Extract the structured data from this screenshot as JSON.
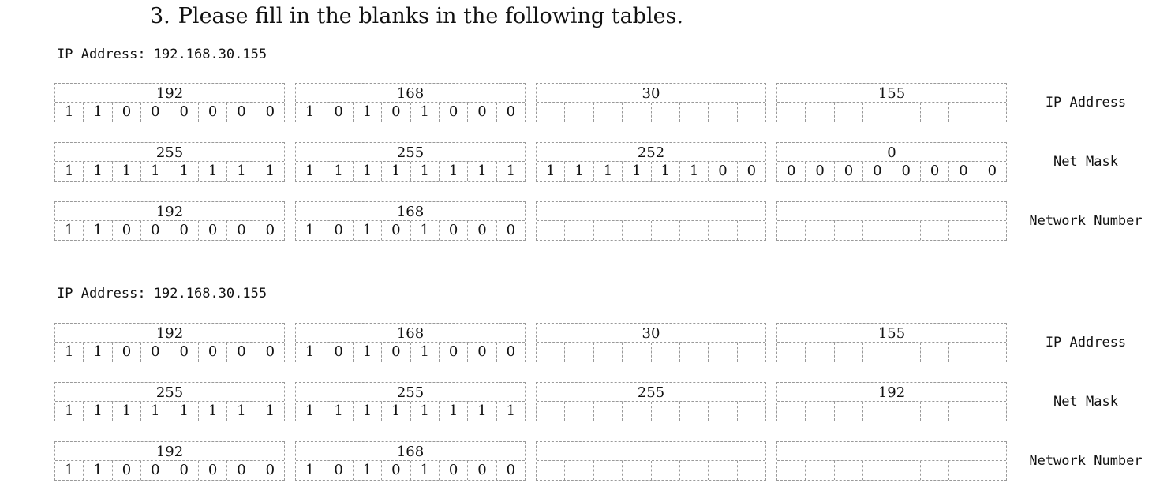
{
  "heading": {
    "number": "3.",
    "text": "Please fill in the blanks in the following tables."
  },
  "tables": [
    {
      "ip_line": "IP Address: 192.168.30.155",
      "rows": [
        {
          "label": "IP Address",
          "octets": [
            {
              "dec": "192",
              "bits": [
                "1",
                "1",
                "0",
                "0",
                "0",
                "0",
                "0",
                "0"
              ]
            },
            {
              "dec": "168",
              "bits": [
                "1",
                "0",
                "1",
                "0",
                "1",
                "0",
                "0",
                "0"
              ]
            },
            {
              "dec": "30",
              "bits": [
                "",
                "",
                "",
                "",
                "",
                "",
                "",
                ""
              ]
            },
            {
              "dec": "155",
              "bits": [
                "",
                "",
                "",
                "",
                "",
                "",
                "",
                ""
              ]
            }
          ]
        },
        {
          "label": "Net Mask",
          "octets": [
            {
              "dec": "255",
              "bits": [
                "1",
                "1",
                "1",
                "1",
                "1",
                "1",
                "1",
                "1"
              ]
            },
            {
              "dec": "255",
              "bits": [
                "1",
                "1",
                "1",
                "1",
                "1",
                "1",
                "1",
                "1"
              ]
            },
            {
              "dec": "252",
              "bits": [
                "1",
                "1",
                "1",
                "1",
                "1",
                "1",
                "0",
                "0"
              ]
            },
            {
              "dec": "0",
              "bits": [
                "0",
                "0",
                "0",
                "0",
                "0",
                "0",
                "0",
                "0"
              ]
            }
          ]
        },
        {
          "label": "Network Number",
          "octets": [
            {
              "dec": "192",
              "bits": [
                "1",
                "1",
                "0",
                "0",
                "0",
                "0",
                "0",
                "0"
              ]
            },
            {
              "dec": "168",
              "bits": [
                "1",
                "0",
                "1",
                "0",
                "1",
                "0",
                "0",
                "0"
              ]
            },
            {
              "dec": "",
              "bits": [
                "",
                "",
                "",
                "",
                "",
                "",
                "",
                ""
              ]
            },
            {
              "dec": "",
              "bits": [
                "",
                "",
                "",
                "",
                "",
                "",
                "",
                ""
              ]
            }
          ]
        }
      ]
    },
    {
      "ip_line": "IP Address: 192.168.30.155",
      "rows": [
        {
          "label": "IP Address",
          "octets": [
            {
              "dec": "192",
              "bits": [
                "1",
                "1",
                "0",
                "0",
                "0",
                "0",
                "0",
                "0"
              ]
            },
            {
              "dec": "168",
              "bits": [
                "1",
                "0",
                "1",
                "0",
                "1",
                "0",
                "0",
                "0"
              ]
            },
            {
              "dec": "30",
              "bits": [
                "",
                "",
                "",
                "",
                "",
                "",
                "",
                ""
              ]
            },
            {
              "dec": "155",
              "bits": [
                "",
                "",
                "",
                "",
                "",
                "",
                "",
                ""
              ]
            }
          ]
        },
        {
          "label": "Net Mask",
          "octets": [
            {
              "dec": "255",
              "bits": [
                "1",
                "1",
                "1",
                "1",
                "1",
                "1",
                "1",
                "1"
              ]
            },
            {
              "dec": "255",
              "bits": [
                "1",
                "1",
                "1",
                "1",
                "1",
                "1",
                "1",
                "1"
              ]
            },
            {
              "dec": "255",
              "bits": [
                "",
                "",
                "",
                "",
                "",
                "",
                "",
                ""
              ]
            },
            {
              "dec": "192",
              "bits": [
                "",
                "",
                "",
                "",
                "",
                "",
                "",
                ""
              ]
            }
          ]
        },
        {
          "label": "Network Number",
          "octets": [
            {
              "dec": "192",
              "bits": [
                "1",
                "1",
                "0",
                "0",
                "0",
                "0",
                "0",
                "0"
              ]
            },
            {
              "dec": "168",
              "bits": [
                "1",
                "0",
                "1",
                "0",
                "1",
                "0",
                "0",
                "0"
              ]
            },
            {
              "dec": "",
              "bits": [
                "",
                "",
                "",
                "",
                "",
                "",
                "",
                ""
              ]
            },
            {
              "dec": "",
              "bits": [
                "",
                "",
                "",
                "",
                "",
                "",
                "",
                ""
              ]
            }
          ]
        }
      ]
    }
  ]
}
